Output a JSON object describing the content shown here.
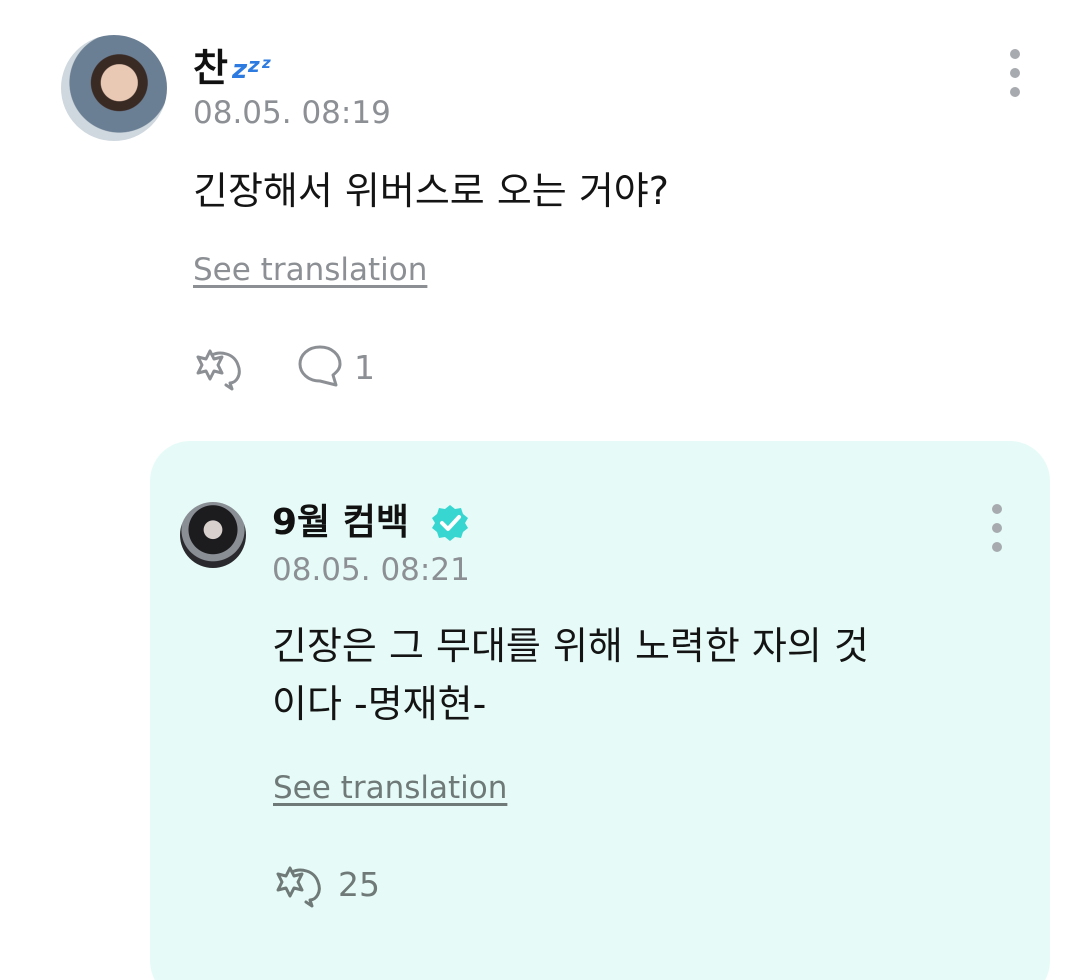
{
  "post": {
    "author": "찬",
    "status_emoji": "zzz",
    "timestamp": "08.05. 08:19",
    "text": "긴장해서 위버스로 오는 거야?",
    "see_translation": "See translation",
    "comment_count": "1",
    "icons": {
      "like": "cheer-icon",
      "comment": "speech-bubble-icon",
      "more": "more-vertical-icon"
    }
  },
  "reply": {
    "author": "9월 컴백",
    "verified": true,
    "timestamp": "08.05. 08:21",
    "text_line1": "긴장은 그 무대를 위해 노력한 자의 것",
    "text_line2": "이다 -명재현-",
    "see_translation": "See translation",
    "like_count": "25",
    "icons": {
      "like": "cheer-icon",
      "verified": "verified-badge-icon",
      "more": "more-vertical-icon"
    }
  },
  "colors": {
    "reply_background": "#e6fbf7",
    "verified_badge": "#37d6d0",
    "zzz": "#2d7be0",
    "muted_text": "#8c8f94"
  }
}
